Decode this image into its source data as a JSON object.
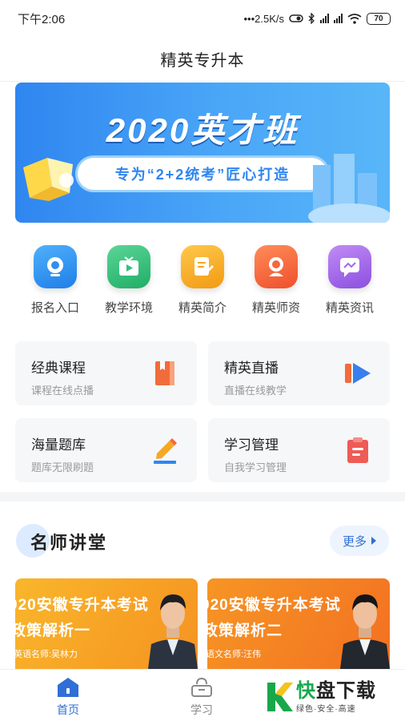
{
  "status_bar": {
    "time": "下午2:06",
    "network_speed": "•••2.5K/s",
    "battery": "70"
  },
  "nav": {
    "title": "精英专升本"
  },
  "banner": {
    "title": "2020英才班",
    "subtitle": "专为“2+2统考”匠心打造"
  },
  "quick_links": [
    {
      "label": "报名入口",
      "icon": "camera-icon",
      "color": "#2f8ff0"
    },
    {
      "label": "教学环境",
      "icon": "tv-play-icon",
      "color": "#35c07b"
    },
    {
      "label": "精英简介",
      "icon": "document-edit-icon",
      "color": "#f7a623"
    },
    {
      "label": "精英师资",
      "icon": "teacher-icon",
      "color": "#f5683a"
    },
    {
      "label": "精英资讯",
      "icon": "chat-bubble-icon",
      "color": "#a567e8"
    }
  ],
  "features": [
    {
      "title": "经典课程",
      "subtitle": "课程在线点播",
      "icon": "book-icon"
    },
    {
      "title": "精英直播",
      "subtitle": "直播在线教学",
      "icon": "live-play-icon"
    },
    {
      "title": "海量题库",
      "subtitle": "题库无限刷题",
      "icon": "pencil-icon"
    },
    {
      "title": "学习管理",
      "subtitle": "自我学习管理",
      "icon": "clipboard-icon"
    }
  ],
  "section": {
    "title": "名师讲堂",
    "more_label": "更多"
  },
  "lectures": [
    {
      "line1": "020安徽专升本考试",
      "line2": "政策解析一",
      "teacher": "英语名师:吴林力"
    },
    {
      "line1": "020安徽专升本考试",
      "line2": "政策解析二",
      "teacher": "语文名师:汪伟"
    }
  ],
  "tabs": {
    "home_label": "首页",
    "study_label": "学习"
  },
  "watermark": {
    "main_green": "快",
    "main_black": "盘下载",
    "sub": "绿色·安全·高速"
  },
  "colors": {
    "accent": "#2f6fd6",
    "banner_blue": "#2f86f0",
    "card_bg": "#f6f7f9"
  }
}
